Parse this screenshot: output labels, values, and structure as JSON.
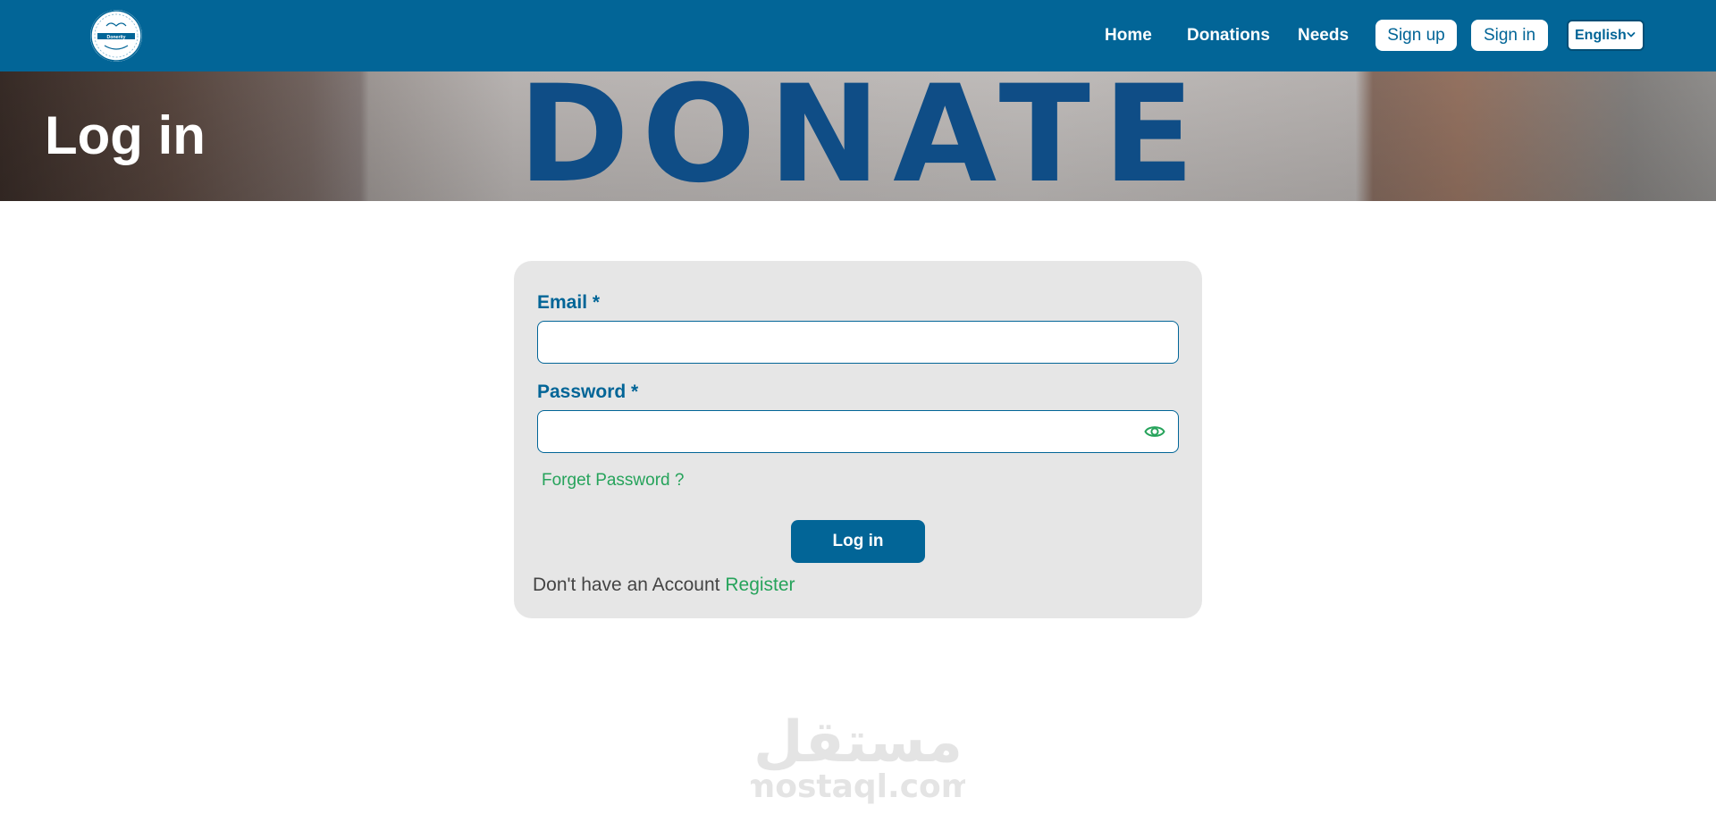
{
  "navbar": {
    "brand": "Donerity",
    "links": {
      "home": "Home",
      "donations": "Donations",
      "needs": "Needs"
    },
    "buttons": {
      "signup": "Sign up",
      "signin": "Sign in"
    },
    "language": {
      "selected": "English"
    }
  },
  "hero": {
    "title": "Log in",
    "banner_word": "DONATE"
  },
  "form": {
    "email_label": "Email *",
    "email_value": "",
    "password_label": "Password *",
    "password_value": "",
    "forget_password": "Forget Password ?",
    "login_button": "Log in",
    "no_account_text": "Don't have an Account",
    "register_link": "Register"
  },
  "watermark": {
    "arabic": "مستقل",
    "latin": "mostaql.com"
  },
  "colors": {
    "primary": "#026597",
    "success": "#26a35b",
    "card": "#e6e6e6",
    "donate_letters": "#0f4d86"
  }
}
